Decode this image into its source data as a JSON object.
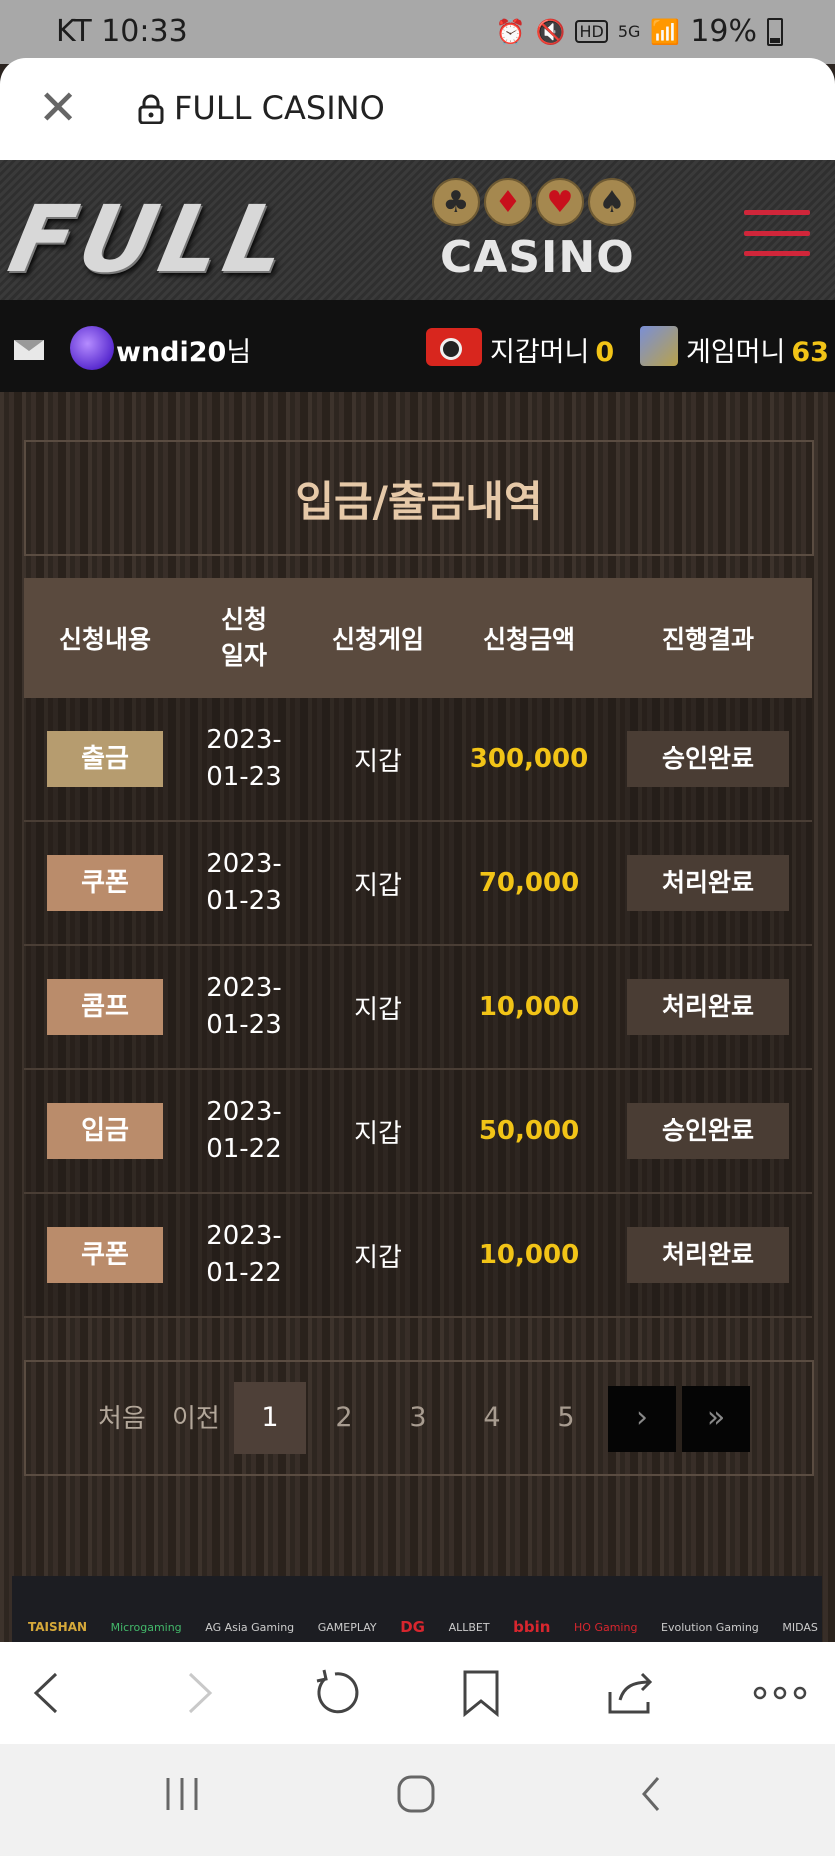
{
  "status_bar": {
    "carrier": "KT",
    "time": "10:33",
    "battery": "19%",
    "network": "5G"
  },
  "browser": {
    "page_title": "FULL CASINO"
  },
  "logo": {
    "main": "FULL",
    "sub": "CASINO",
    "suits": [
      "♣",
      "♦",
      "♥",
      "♠"
    ]
  },
  "user": {
    "username": "wndi20",
    "honorific": "님",
    "wallet_label": "지갑머니",
    "wallet_value": "0",
    "game_label": "게임머니",
    "game_value": "63"
  },
  "page": {
    "title": "입금/출금내역"
  },
  "table": {
    "headers": {
      "type": "신청내용",
      "date_line1": "신청",
      "date_line2": "일자",
      "game": "신청게임",
      "amount": "신청금액",
      "result": "진행결과"
    },
    "rows": [
      {
        "type": "출금",
        "date_y": "2023-",
        "date_md": "01-23",
        "game": "지갑",
        "amount": "300,000",
        "result": "승인완료"
      },
      {
        "type": "쿠폰",
        "date_y": "2023-",
        "date_md": "01-23",
        "game": "지갑",
        "amount": "70,000",
        "result": "처리완료"
      },
      {
        "type": "콤프",
        "date_y": "2023-",
        "date_md": "01-23",
        "game": "지갑",
        "amount": "10,000",
        "result": "처리완료"
      },
      {
        "type": "입금",
        "date_y": "2023-",
        "date_md": "01-22",
        "game": "지갑",
        "amount": "50,000",
        "result": "승인완료"
      },
      {
        "type": "쿠폰",
        "date_y": "2023-",
        "date_md": "01-22",
        "game": "지갑",
        "amount": "10,000",
        "result": "처리완료"
      }
    ]
  },
  "pagination": {
    "first": "처음",
    "prev": "이전",
    "pages": [
      "1",
      "2",
      "3",
      "4",
      "5"
    ],
    "current": "1",
    "next_symbol": "›",
    "last_symbol": "»"
  },
  "partners": [
    "TAISHAN",
    "Microgaming",
    "AG Asia Gaming",
    "GAMEPLAY",
    "DG",
    "ALLBET",
    "bbin",
    "HO Gaming",
    "Evolution Gaming",
    "MIDAS"
  ],
  "colors": {
    "accent_gold": "#f2c417",
    "title": "#e6c9a8",
    "header_bg": "#5a4a3e",
    "menu_red": "#d0263a"
  }
}
